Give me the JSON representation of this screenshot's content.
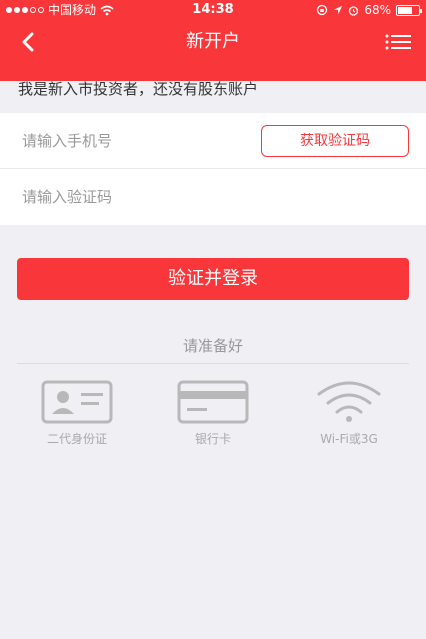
{
  "status_bar": {
    "carrier": "中国移动",
    "time": "14:38",
    "battery_percent": "68%",
    "battery_level": 0.68
  },
  "nav": {
    "title": "新开户",
    "back_icon": "chevron-left-icon",
    "menu_icon": "list-menu-icon"
  },
  "hint_text": "我是新入市投资者，还没有股东账户",
  "form": {
    "phone_placeholder": "请输入手机号",
    "phone_value": "",
    "code_placeholder": "请输入验证码",
    "code_value": "",
    "get_code_label": "获取验证码"
  },
  "login_label": "验证并登录",
  "prepare": {
    "title": "请准备好",
    "items": [
      {
        "label": "二代身份证",
        "icon": "id-card-icon"
      },
      {
        "label": "银行卡",
        "icon": "bank-card-icon"
      },
      {
        "label": "Wi-Fi或3G",
        "icon": "wifi-icon"
      }
    ]
  },
  "colors": {
    "accent": "#f9363a",
    "background": "#efeff4",
    "icon_gray": "#b8b8b8"
  }
}
